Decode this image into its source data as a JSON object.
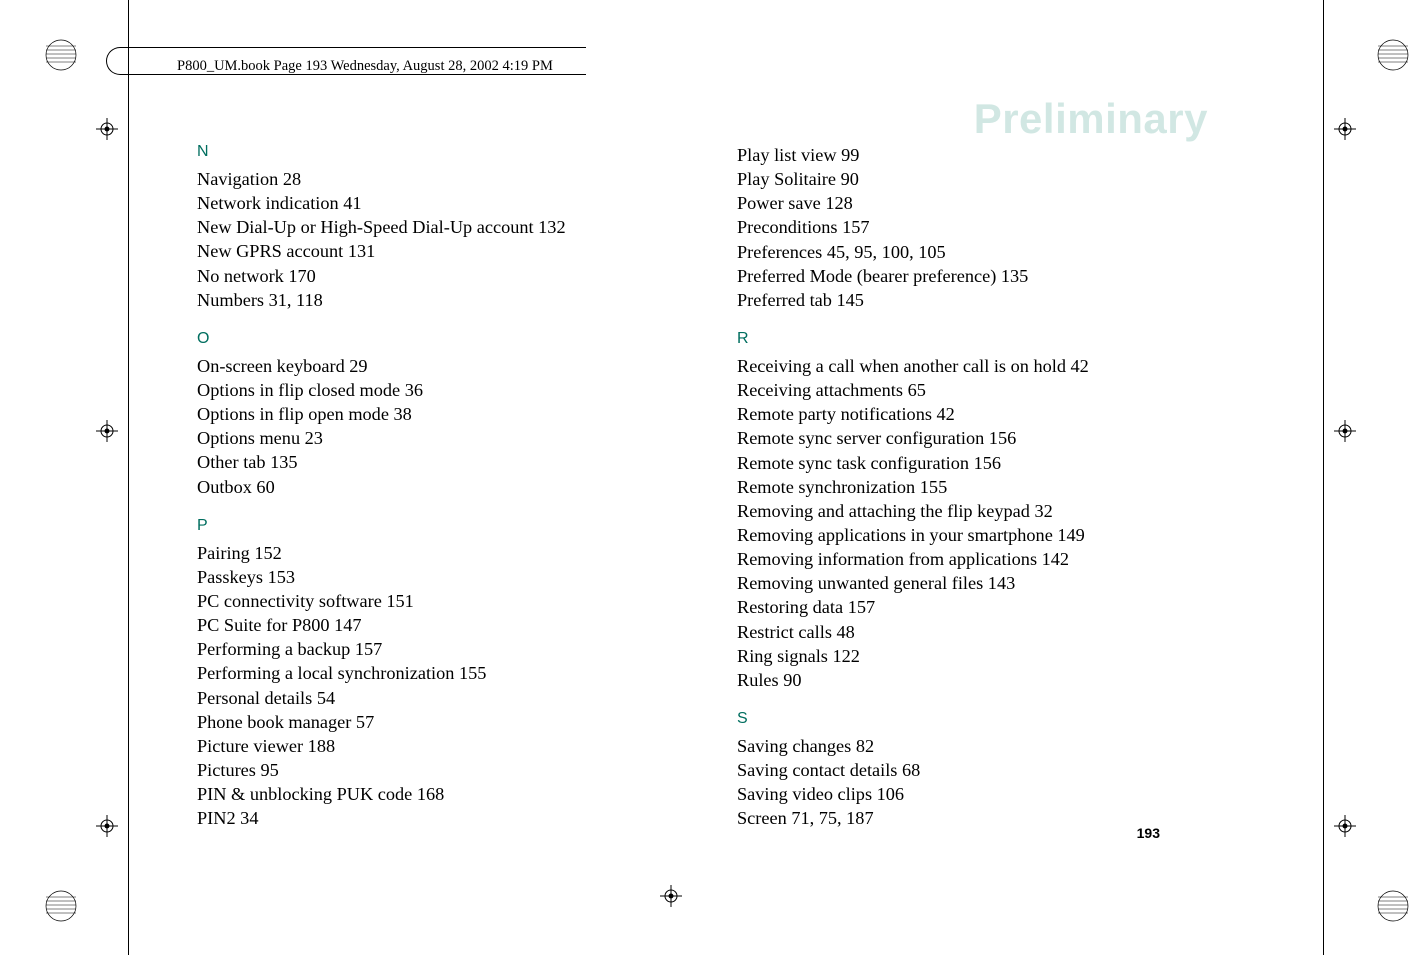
{
  "header": "P800_UM.book  Page 193  Wednesday, August 28, 2002  4:19 PM",
  "watermark": "Preliminary",
  "page_number": "193",
  "left_column": {
    "sections": [
      {
        "letter": "N",
        "entries": [
          {
            "text": "Navigation",
            "pages": "28"
          },
          {
            "text": "Network indication",
            "pages": "41"
          },
          {
            "text": "New Dial-Up or High-Speed Dial-Up account",
            "pages": "132"
          },
          {
            "text": "New GPRS account",
            "pages": "131"
          },
          {
            "text": "No network",
            "pages": "170"
          },
          {
            "text": "Numbers",
            "pages": "31, 118"
          }
        ]
      },
      {
        "letter": "O",
        "entries": [
          {
            "text": "On-screen keyboard",
            "pages": "29"
          },
          {
            "text": "Options in flip closed mode",
            "pages": "36"
          },
          {
            "text": "Options in flip open mode",
            "pages": "38"
          },
          {
            "text": "Options menu",
            "pages": "23"
          },
          {
            "text": "Other tab",
            "pages": "135"
          },
          {
            "text": "Outbox",
            "pages": "60"
          }
        ]
      },
      {
        "letter": "P",
        "entries": [
          {
            "text": "Pairing",
            "pages": "152"
          },
          {
            "text": "Passkeys",
            "pages": "153"
          },
          {
            "text": "PC connectivity software",
            "pages": "151"
          },
          {
            "text": "PC Suite for P800",
            "pages": "147"
          },
          {
            "text": "Performing a backup",
            "pages": "157"
          },
          {
            "text": "Performing a local synchronization",
            "pages": "155"
          },
          {
            "text": "Personal details",
            "pages": "54"
          },
          {
            "text": "Phone book manager",
            "pages": "57"
          },
          {
            "text": "Picture viewer",
            "pages": "188"
          },
          {
            "text": "Pictures",
            "pages": "95"
          },
          {
            "text": "PIN & unblocking PUK code",
            "pages": "168"
          },
          {
            "text": "PIN2",
            "pages": "34"
          }
        ]
      }
    ]
  },
  "right_column": {
    "pre_entries": [
      {
        "text": "Play list view",
        "pages": "99"
      },
      {
        "text": "Play Solitaire",
        "pages": "90"
      },
      {
        "text": "Power save",
        "pages": "128"
      },
      {
        "text": "Preconditions",
        "pages": "157"
      },
      {
        "text": "Preferences",
        "pages": "45, 95, 100, 105"
      },
      {
        "text": "Preferred Mode (bearer preference)",
        "pages": "135"
      },
      {
        "text": "Preferred tab",
        "pages": "145"
      }
    ],
    "sections": [
      {
        "letter": "R",
        "entries": [
          {
            "text": "Receiving a call when another call is on hold",
            "pages": "42"
          },
          {
            "text": "Receiving attachments",
            "pages": "65"
          },
          {
            "text": "Remote party notifications",
            "pages": "42"
          },
          {
            "text": "Remote sync server configuration",
            "pages": "156"
          },
          {
            "text": "Remote sync task configuration",
            "pages": "156"
          },
          {
            "text": "Remote synchronization",
            "pages": "155"
          },
          {
            "text": "Removing and attaching the flip keypad",
            "pages": "32"
          },
          {
            "text": "Removing applications in your smartphone",
            "pages": "149"
          },
          {
            "text": "Removing information from applications",
            "pages": "142"
          },
          {
            "text": "Removing unwanted general files",
            "pages": "143"
          },
          {
            "text": "Restoring data",
            "pages": "157"
          },
          {
            "text": "Restrict calls",
            "pages": "48"
          },
          {
            "text": "Ring signals",
            "pages": "122"
          },
          {
            "text": "Rules",
            "pages": "90"
          }
        ]
      },
      {
        "letter": "S",
        "entries": [
          {
            "text": "Saving changes",
            "pages": "82"
          },
          {
            "text": "Saving contact details",
            "pages": "68"
          },
          {
            "text": "Saving video clips",
            "pages": "106"
          },
          {
            "text": "Screen",
            "pages": "71, 75, 187"
          }
        ]
      }
    ]
  }
}
